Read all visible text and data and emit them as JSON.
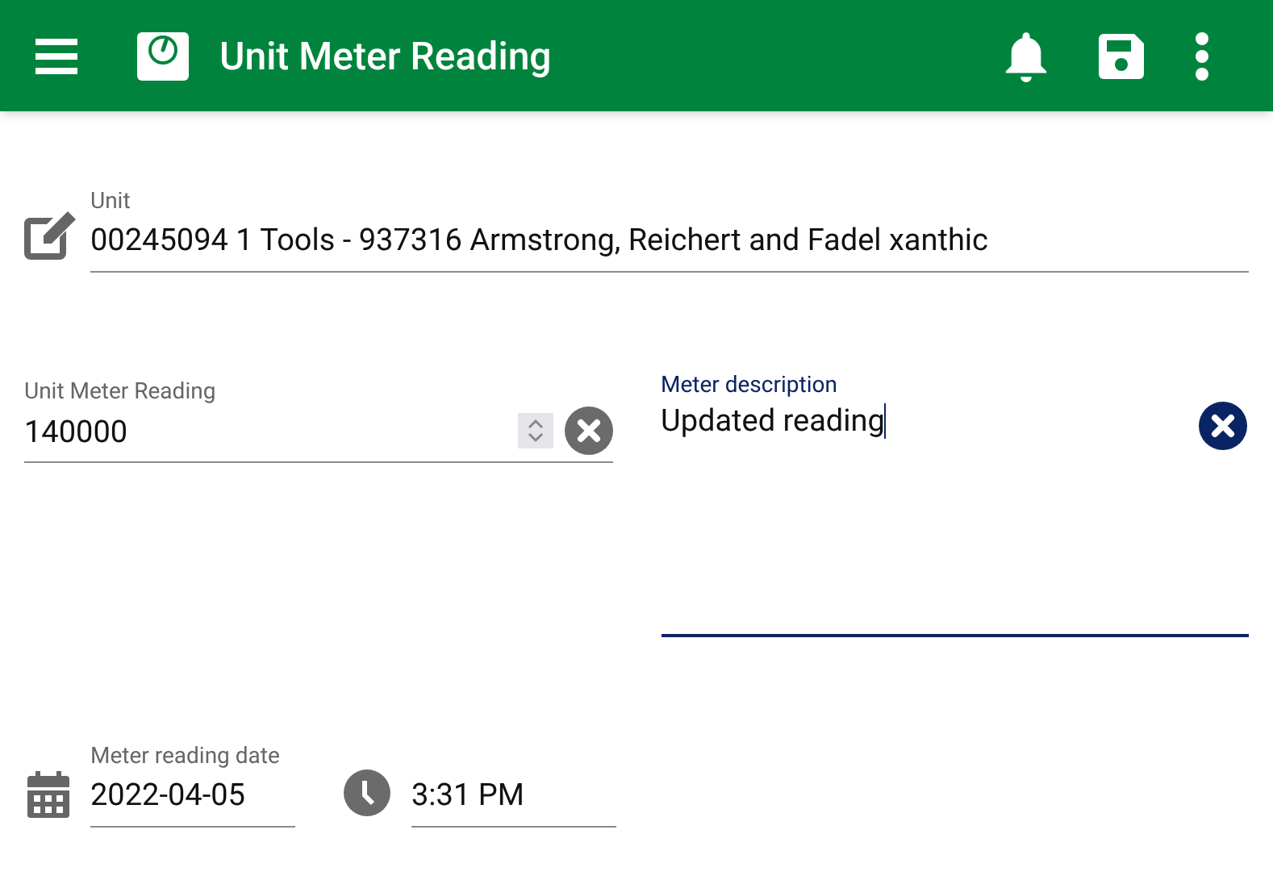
{
  "app_bar": {
    "title": "Unit Meter Reading"
  },
  "unit": {
    "label": "Unit",
    "value": "00245094 1 Tools - 937316 Armstrong, Reichert and Fadel xanthic",
    "focused": false
  },
  "meter_reading": {
    "label": "Unit Meter Reading",
    "value": "140000",
    "focused": false
  },
  "meter_description": {
    "label": "Meter description",
    "value": "Updated reading",
    "focused": true
  },
  "reading_date": {
    "label": "Meter reading date",
    "value": "2022-04-05",
    "focused": false
  },
  "reading_time": {
    "value": "3:31 PM",
    "focused": false
  }
}
